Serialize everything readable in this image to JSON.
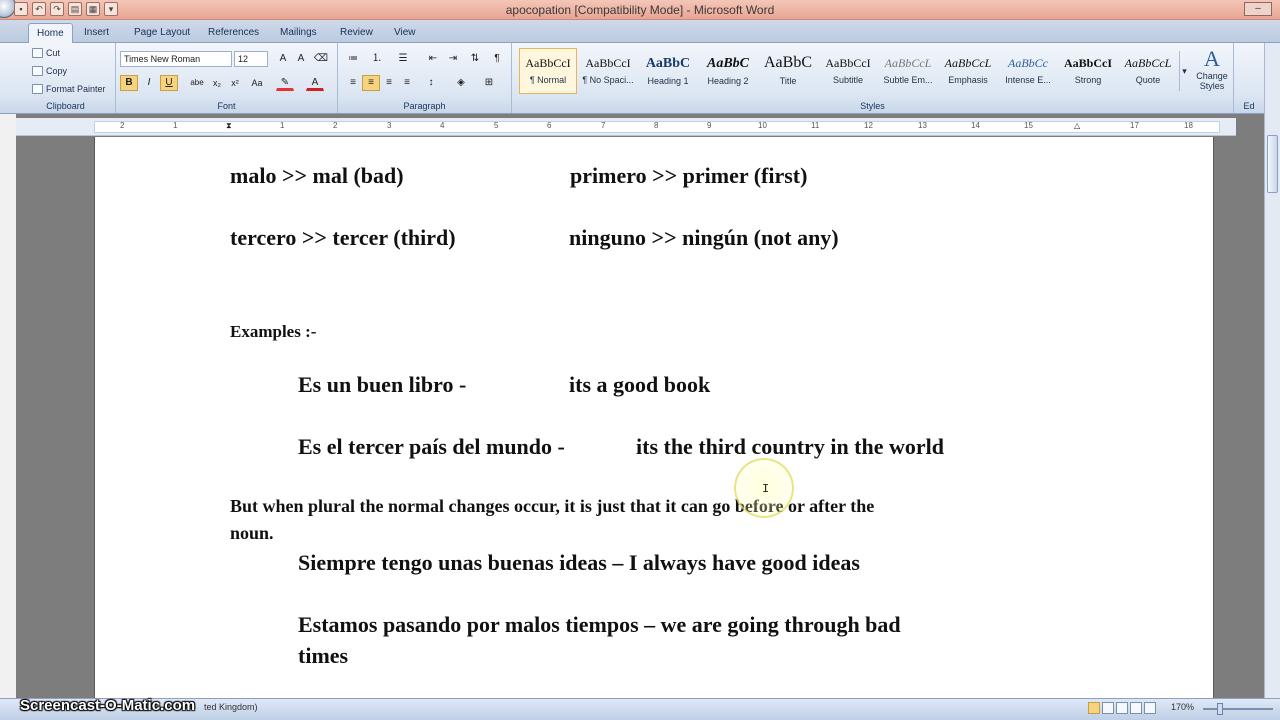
{
  "window": {
    "title": "apocopation [Compatibility Mode] - Microsoft Word",
    "qat_icons": [
      "save-icon",
      "undo-icon",
      "redo-icon",
      "open-icon",
      "print-icon",
      "customize-icon"
    ]
  },
  "tabs": [
    "Home",
    "Insert",
    "Page Layout",
    "References",
    "Mailings",
    "Review",
    "View"
  ],
  "ribbon": {
    "clipboard": {
      "cut": "Cut",
      "copy": "Copy",
      "format_painter": "Format Painter",
      "label": "Clipboard"
    },
    "font": {
      "name": "Times New Roman",
      "size": "12",
      "label": "Font",
      "bold": "B",
      "italic": "I",
      "underline": "U",
      "strike": "abe",
      "sub": "x₂",
      "sup": "x²",
      "case": "Aa"
    },
    "paragraph": {
      "label": "Paragraph"
    },
    "styles": {
      "label": "Styles",
      "items": [
        {
          "sample": "AaBbCcI",
          "name": "¶ Normal"
        },
        {
          "sample": "AaBbCcI",
          "name": "¶ No Spaci..."
        },
        {
          "sample": "AaBbC",
          "name": "Heading 1"
        },
        {
          "sample": "AaBbC",
          "name": "Heading 2"
        },
        {
          "sample": "AaBbC",
          "name": "Title"
        },
        {
          "sample": "AaBbCcI",
          "name": "Subtitle"
        },
        {
          "sample": "AaBbCcL",
          "name": "Subtle Em..."
        },
        {
          "sample": "AaBbCcL",
          "name": "Emphasis"
        },
        {
          "sample": "AaBbCc",
          "name": "Intense E..."
        },
        {
          "sample": "AaBbCcI",
          "name": "Strong"
        },
        {
          "sample": "AaBbCcL",
          "name": "Quote"
        }
      ],
      "change_styles": "Change Styles"
    },
    "editing_label": "Ed"
  },
  "ruler": {
    "ticks": [
      "2",
      "1",
      "1",
      "2",
      "3",
      "4",
      "5",
      "6",
      "7",
      "8",
      "9",
      "10",
      "11",
      "12",
      "13",
      "14",
      "15",
      "16",
      "17",
      "18"
    ]
  },
  "document": {
    "pair1_left": "malo >> mal (bad)",
    "pair1_right": "primero >> primer (first)",
    "pair2_left": "tercero >> tercer (third)",
    "pair2_right": "ninguno >> ningún (not any)",
    "examples_heading": "Examples :-",
    "ex1_es": "Es un buen libro   -",
    "ex1_en": "its a good book",
    "ex2_es": "Es el tercer país del mundo -",
    "ex2_en": "its the third country in the world",
    "plural_line1": "But when plural the normal changes occur, it is just that it can go before or after the",
    "plural_line2": "noun.",
    "ex3": "Siempre tengo unas buenas ideas – I always have good ideas",
    "ex4_line1": "Estamos pasando por malos tiempos – we are going through bad",
    "ex4_line2": "times"
  },
  "statusbar": {
    "language": "ted Kingdom)",
    "zoom": "170%"
  },
  "watermark": "Screencast-O-Matic.com"
}
